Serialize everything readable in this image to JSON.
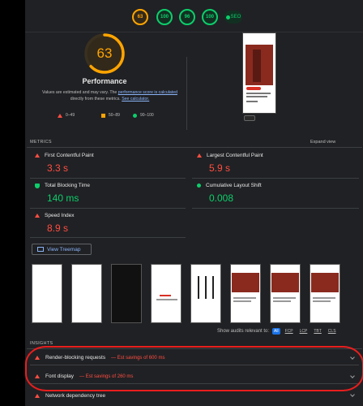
{
  "topbar": {
    "scores": [
      {
        "value": "63",
        "status": "average"
      },
      {
        "value": "100",
        "status": "pass"
      },
      {
        "value": "96",
        "status": "pass"
      },
      {
        "value": "100",
        "status": "pass"
      }
    ],
    "pwa_label": "SEO",
    "pwa_icon": "pwa-dot-icon"
  },
  "performance": {
    "score": "63",
    "score_fraction": 0.63,
    "title": "Performance",
    "desc_1": "Values are estimated and may vary. The ",
    "desc_link_1": "performance score is calculated",
    "desc_2": " directly from these metrics. ",
    "desc_link_2": "See calculator.",
    "legend": [
      {
        "range": "0–49",
        "icon": "fail-triangle-icon"
      },
      {
        "range": "50–89",
        "icon": "average-square-icon"
      },
      {
        "range": "90–100",
        "icon": "pass-circle-icon"
      }
    ]
  },
  "metrics": {
    "header": "METRICS",
    "expand_label": "Expand view",
    "items": [
      {
        "label": "First Contentful Paint",
        "value": "3.3 s",
        "status": "fail"
      },
      {
        "label": "Largest Contentful Paint",
        "value": "5.9 s",
        "status": "fail"
      },
      {
        "label": "Total Blocking Time",
        "value": "140 ms",
        "status": "pass"
      },
      {
        "label": "Cumulative Layout Shift",
        "value": "0.008",
        "status": "pass"
      },
      {
        "label": "Speed Index",
        "value": "8.9 s",
        "status": "fail"
      }
    ]
  },
  "treemap_label": "View Treemap",
  "audits_filter": {
    "label": "Show audits relevant to:",
    "options": [
      "All",
      "FCP",
      "LCP",
      "TBT",
      "CLS"
    ],
    "selected": "All"
  },
  "insights": {
    "header": "INSIGHTS",
    "items": [
      {
        "title": "Render-blocking requests",
        "savings": "— Est savings of 600 ms"
      },
      {
        "title": "Font display",
        "savings": "— Est savings of 260 ms"
      },
      {
        "title": "Network dependency tree",
        "savings": ""
      }
    ]
  },
  "colors": {
    "fail": "#ff4e42",
    "average": "#ffa400",
    "pass": "#0cce6b",
    "link": "#8ab4f8",
    "annotation": "#e81e1e"
  }
}
